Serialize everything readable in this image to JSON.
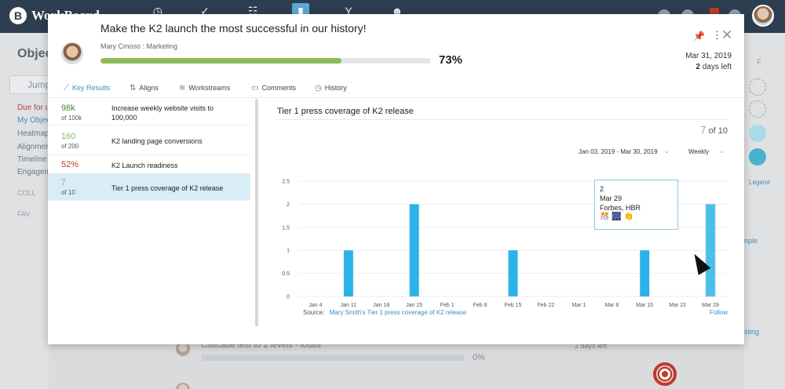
{
  "app": {
    "logo_text": "WorkBoard",
    "nav_icons": [
      "dashboard-icon",
      "check-icon",
      "grid-icon",
      "chart-icon",
      "fork-icon",
      "people-icon"
    ]
  },
  "background": {
    "page_title": "Objec",
    "search_placeholder": "Jump",
    "links": [
      "Due for u",
      "My Objec",
      "Heatmap",
      "Alignmer",
      "Timeline",
      "Engagem"
    ],
    "sections": [
      "COLL",
      "FAV"
    ],
    "row_title": "Cascade test to 2 levels - totals",
    "row_days": "2 days left",
    "row_percent": "0%",
    "right_col_header": "F",
    "legend": "Legend",
    "right_links": [
      "nple",
      "sting"
    ]
  },
  "modal": {
    "title": "Make the K2 launch the most successful in our history!",
    "owner": "Mary Cmoso : Marketing",
    "progress": 73,
    "progress_label": "73%",
    "due_date": "Mar 31, 2019",
    "days_left_number": "2",
    "days_left_text": " days left",
    "tabs": [
      {
        "label": "Key Results",
        "icon": "trend-icon",
        "active": true
      },
      {
        "label": "Aligns",
        "icon": "align-icon",
        "active": false
      },
      {
        "label": "Workstreams",
        "icon": "workstreams-icon",
        "active": false
      },
      {
        "label": "Comments",
        "icon": "comment-icon",
        "active": false
      },
      {
        "label": "History",
        "icon": "clock-icon",
        "active": false
      }
    ],
    "key_results": [
      {
        "value": "98k",
        "sub": "of 100k",
        "label": "Increase weekly website visits to 100,000",
        "color": "#3f8a2e"
      },
      {
        "value": "160",
        "sub": "of 200",
        "label": "K2 landing page conversions",
        "color": "#8dbb5a"
      },
      {
        "value": "52%",
        "sub": "",
        "label": "K2 Launch readiness",
        "color": "#c0392b"
      },
      {
        "value": "7",
        "sub": "of 10",
        "label": "Tier 1 press coverage of K2 release",
        "color": "#8dbb5a"
      }
    ]
  },
  "chart_panel": {
    "title": "Tier 1 press coverage of K2 release",
    "count_value": "7",
    "count_total": " of 10",
    "date_range": "Jan 03, 2019 - Mar 30, 2019",
    "period": "Weekly",
    "source_label": "Source:",
    "source_link": "Mary Smith's Tier 1 press coverage of K2 release",
    "follow": "Follow",
    "tooltip": {
      "value": "2",
      "date": "Mar 29",
      "outlets": "Forbes, HBR",
      "emojis": "🎊 🎆 👏"
    }
  },
  "chart_data": {
    "type": "bar",
    "categories": [
      "Jan 4",
      "Jan 11",
      "Jan 18",
      "Jan 25",
      "Feb 1",
      "Feb 8",
      "Feb 15",
      "Feb 22",
      "Mar 1",
      "Mar 8",
      "Mar 15",
      "Mar 22",
      "Mar 29"
    ],
    "values": [
      0,
      1,
      0,
      2,
      0,
      0,
      1,
      0,
      0,
      0,
      1,
      0,
      2
    ],
    "y_ticks": [
      "0",
      "0.5",
      "1",
      "1.5",
      "2",
      "2.5"
    ],
    "ylim": [
      0,
      2.5
    ],
    "grid": true,
    "bar_color": "#2bb3e8",
    "highlighted_category": "Mar 29"
  }
}
